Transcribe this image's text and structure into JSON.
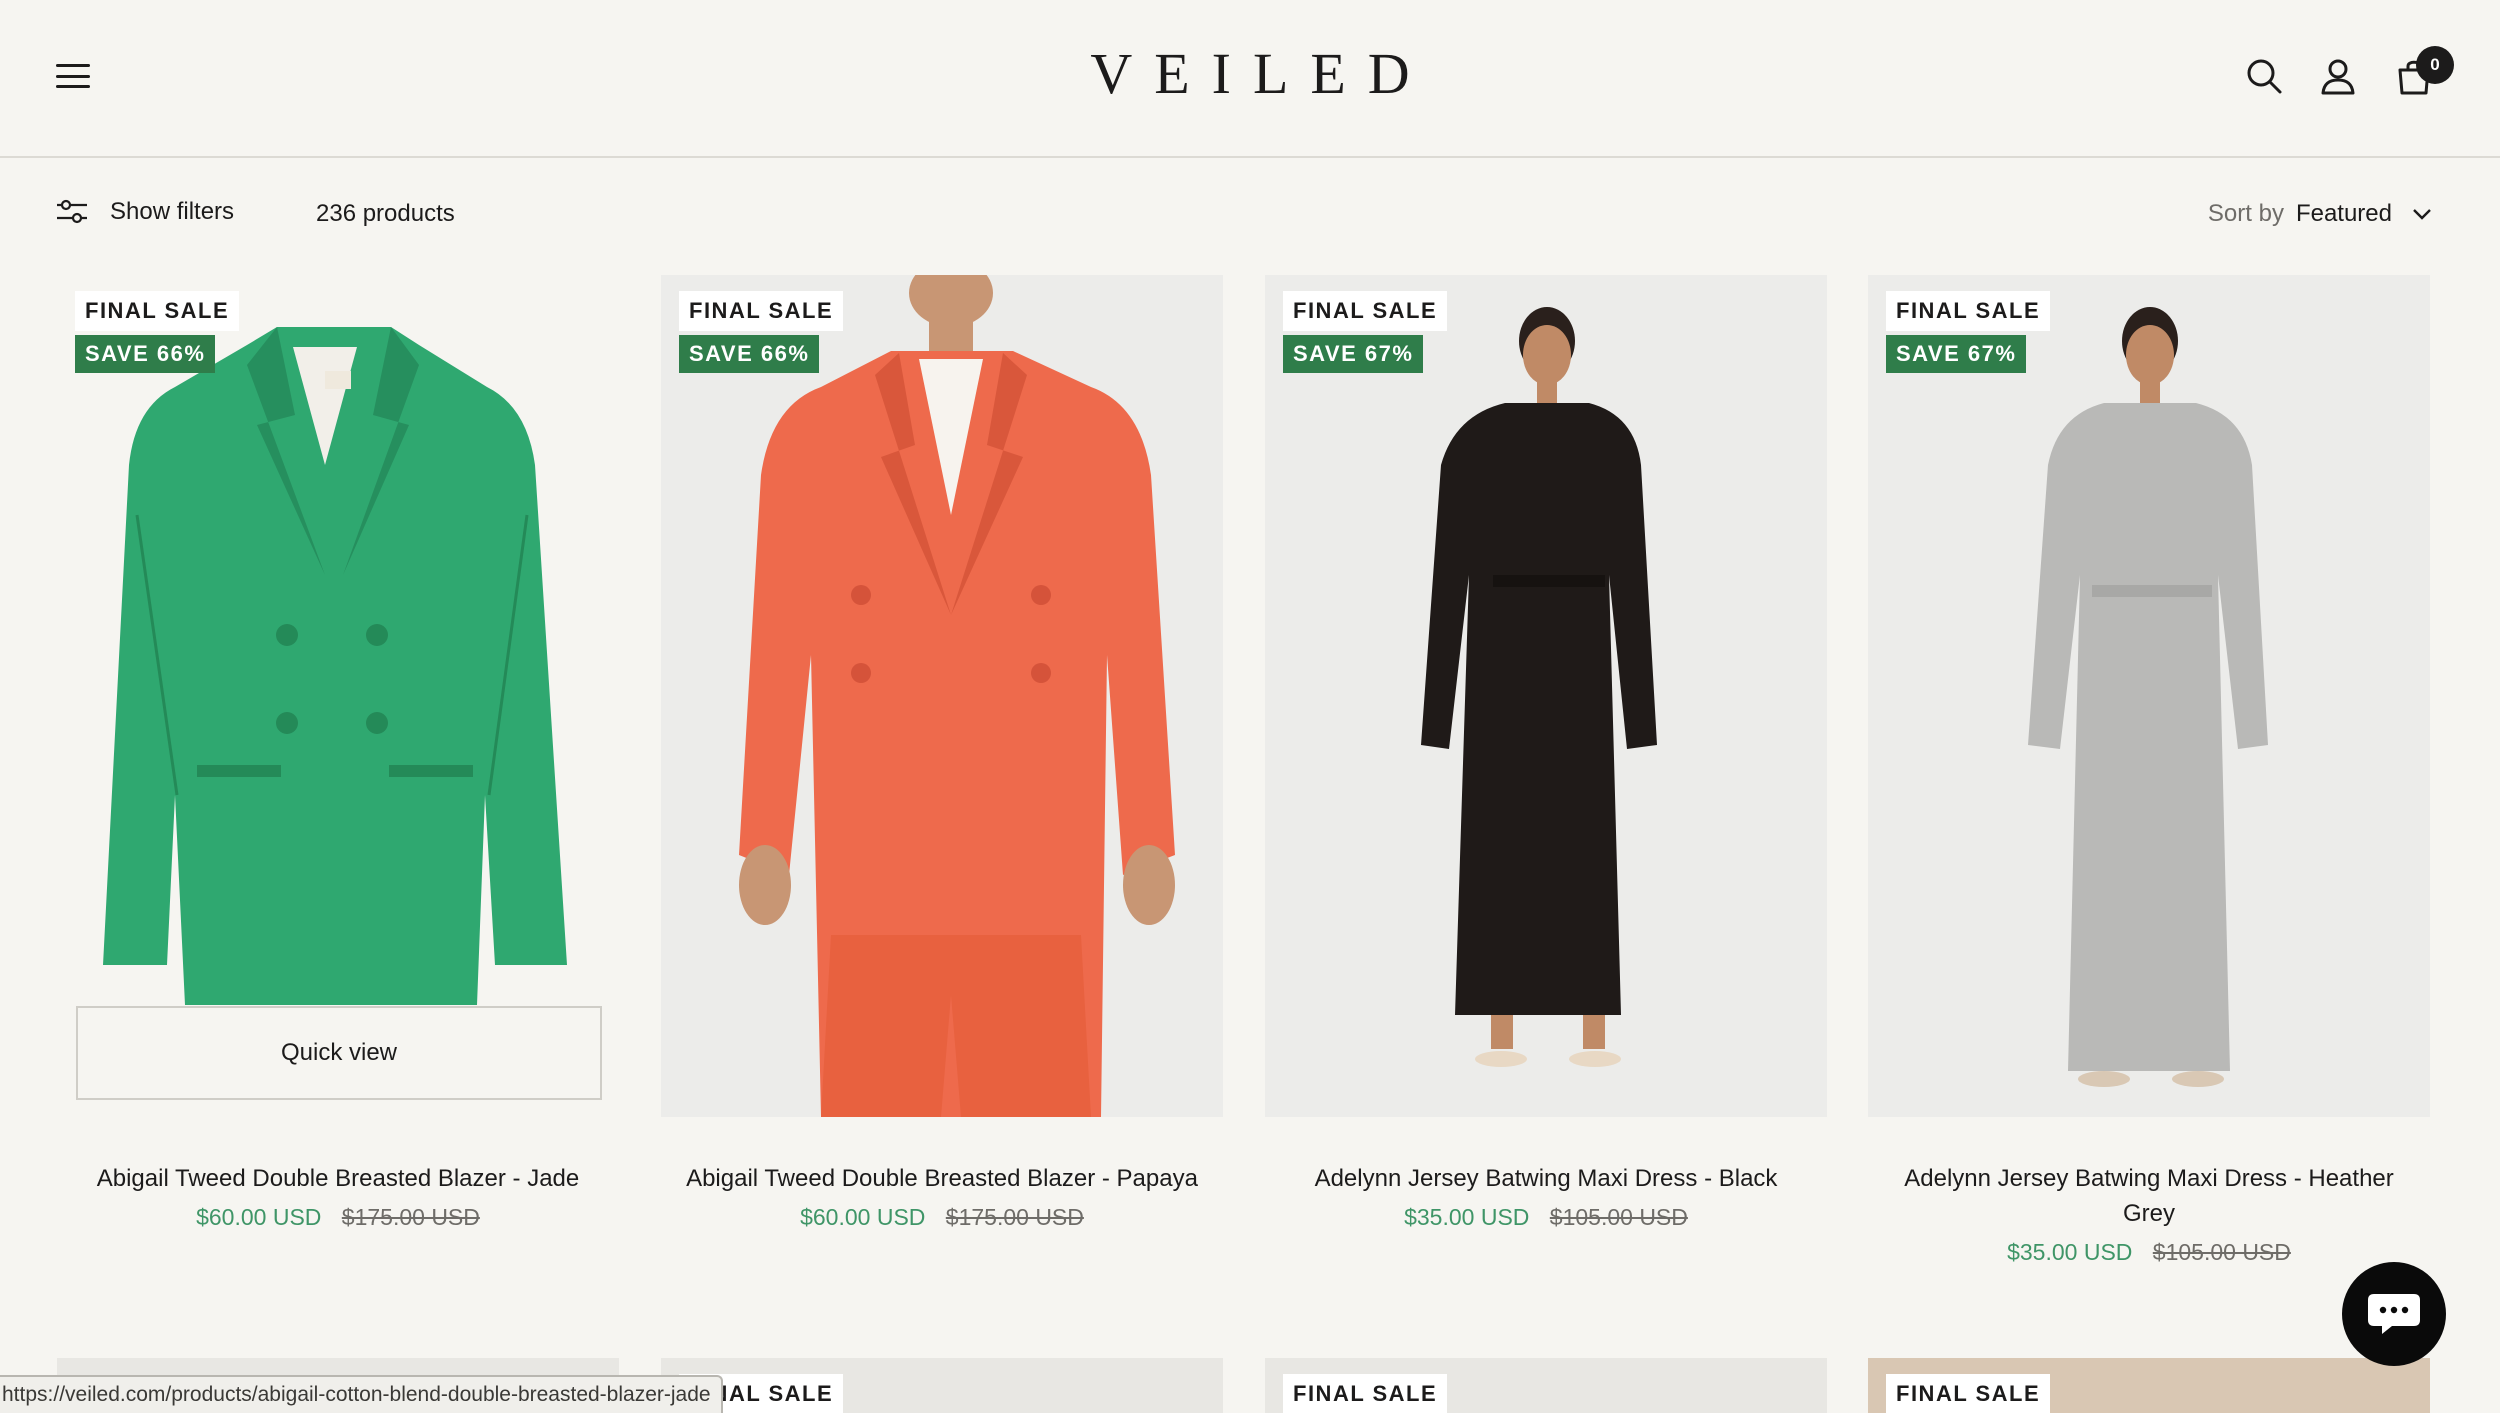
{
  "header": {
    "logo": "VEILED",
    "cart_count": "0"
  },
  "toolbar": {
    "filters_label": "Show filters",
    "product_count": "236 products",
    "sort_label": "Sort by",
    "sort_value": "Featured"
  },
  "products": [
    {
      "badge_final": "FINAL SALE",
      "badge_save": "SAVE 66%",
      "title": "Abigail Tweed Double Breasted Blazer - Jade",
      "price": "$60.00 USD",
      "compare_price": "$175.00 USD",
      "quick_view": "Quick view",
      "color": "#2fa870"
    },
    {
      "badge_final": "FINAL SALE",
      "badge_save": "SAVE 66%",
      "title": "Abigail Tweed Double Breasted Blazer - Papaya",
      "price": "$60.00 USD",
      "compare_price": "$175.00 USD",
      "color": "#ee6a4c"
    },
    {
      "badge_final": "FINAL SALE",
      "badge_save": "SAVE 67%",
      "title": "Adelynn Jersey Batwing Maxi Dress - Black",
      "price": "$35.00 USD",
      "compare_price": "$105.00 USD",
      "color": "#1f1a18"
    },
    {
      "badge_final": "FINAL SALE",
      "badge_save": "SAVE 67%",
      "title": "Adelynn Jersey Batwing Maxi Dress - Heather Grey",
      "price": "$35.00 USD",
      "compare_price": "$105.00 USD",
      "color": "#b9b9b7"
    }
  ],
  "row2": [
    {
      "badge_final": ""
    },
    {
      "badge_final": "FINAL SALE"
    },
    {
      "badge_final": "FINAL SALE"
    },
    {
      "badge_final": "FINAL SALE"
    }
  ],
  "status_url": "https://veiled.com/products/abigail-cotton-blend-double-breasted-blazer-jade",
  "icons": {
    "menu": "hamburger-menu-icon",
    "search": "search-icon",
    "account": "account-icon",
    "cart": "shopping-bag-icon",
    "filters": "sliders-icon",
    "sort": "chevron-down-icon",
    "chat": "chat-bubble-icon"
  }
}
